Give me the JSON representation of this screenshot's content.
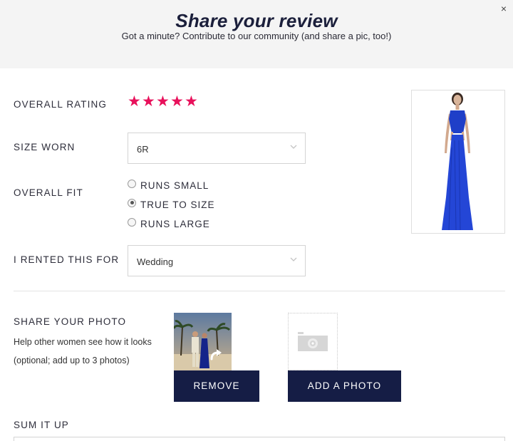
{
  "header": {
    "title": "Share your review",
    "subtitle": "Got a minute? Contribute to our community (and share a pic, too!)",
    "close_symbol": "×"
  },
  "form": {
    "overall_rating": {
      "label": "OVERALL RATING",
      "value": 5,
      "max": 5,
      "star_symbol": "★",
      "color": "#e8115b"
    },
    "size_worn": {
      "label": "SIZE WORN",
      "selected": "6R"
    },
    "overall_fit": {
      "label": "OVERALL FIT",
      "options": [
        {
          "label": "RUNS SMALL",
          "checked": false
        },
        {
          "label": "TRUE TO SIZE",
          "checked": true
        },
        {
          "label": "RUNS LARGE",
          "checked": false
        }
      ]
    },
    "rented_for": {
      "label": "I RENTED THIS FOR",
      "selected": "Wedding"
    },
    "photo": {
      "label": "SHARE YOUR PHOTO",
      "help_line1": "Help other women see how it looks",
      "help_line2": "(optional; add up to 3 photos)",
      "remove_label": "REMOVE",
      "add_label": "ADD A PHOTO"
    },
    "sum_it_up": {
      "label": "SUM IT UP"
    }
  },
  "icons": {
    "close": "close-icon",
    "chevron": "chevron-down-icon",
    "rotate": "rotate-icon",
    "camera": "camera-icon"
  },
  "colors": {
    "accent_pink": "#e8115b",
    "button_navy": "#151d45",
    "title_navy": "#1b1f3b",
    "dress_blue": "#1f3fc8"
  }
}
